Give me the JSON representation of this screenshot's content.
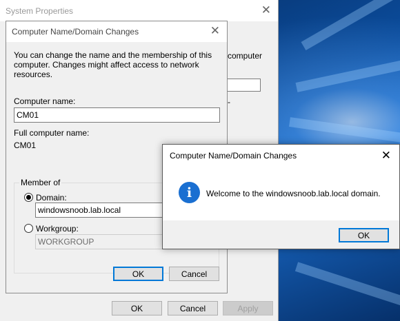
{
  "system_properties": {
    "title": "System Properties",
    "ghost_text": "computer",
    "ghost_dash": "-",
    "buttons": {
      "ok": "OK",
      "cancel": "Cancel",
      "apply": "Apply"
    }
  },
  "domain_dialog": {
    "title": "Computer Name/Domain Changes",
    "intro": "You can change the name and the membership of this computer. Changes might affect access to network resources.",
    "computer_name_label": "Computer name:",
    "computer_name_value": "CM01",
    "full_name_label": "Full computer name:",
    "full_name_value": "CM01",
    "member_of_label": "Member of",
    "domain_label": "Domain:",
    "domain_value": "windowsnoob.lab.local",
    "domain_selected": true,
    "workgroup_label": "Workgroup:",
    "workgroup_value": "WORKGROUP",
    "buttons": {
      "ok": "OK",
      "cancel": "Cancel"
    }
  },
  "message_box": {
    "title": "Computer Name/Domain Changes",
    "icon": "info-icon",
    "icon_glyph": "i",
    "message": "Welcome to the windowsnoob.lab.local domain.",
    "ok_label": "OK"
  },
  "colors": {
    "accent": "#0078d7",
    "info_icon": "#1a6fd1",
    "desktop": "#0b4d9e"
  }
}
